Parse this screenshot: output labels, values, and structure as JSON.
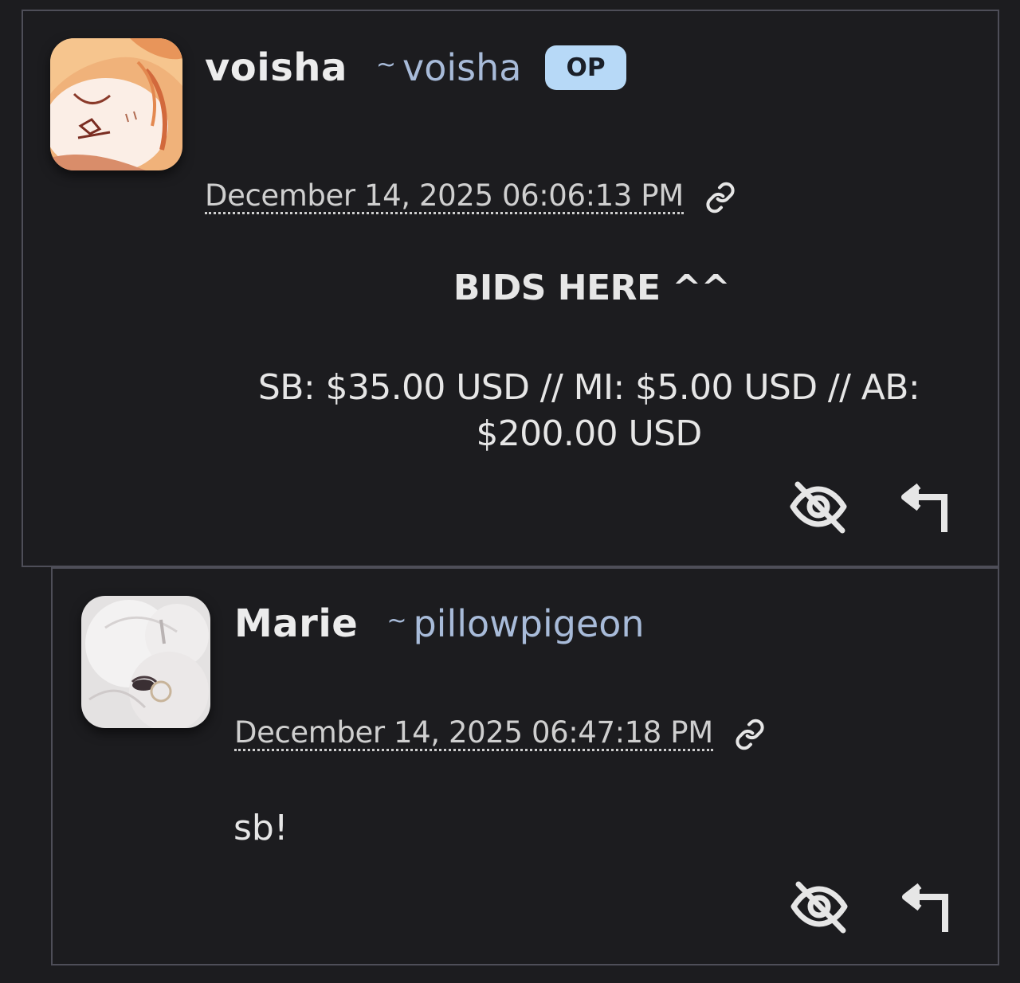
{
  "comments": [
    {
      "display_name": "voisha",
      "username_prefix": "~",
      "username": "voisha",
      "badge": "OP",
      "timestamp": "December 14, 2025 06:06:13 PM",
      "title": "BIDS HERE ^^",
      "text": "SB: $35.00 USD // MI: $5.00 USD // AB: $200.00 USD",
      "icons": [
        "link-icon",
        "hide-icon",
        "reply-icon"
      ]
    },
    {
      "display_name": "Marie",
      "username_prefix": "~",
      "username": "pillowpigeon",
      "timestamp": "December 14, 2025 06:47:18 PM",
      "text": "sb!",
      "icons": [
        "link-icon",
        "hide-icon",
        "reply-icon"
      ]
    }
  ],
  "colors": {
    "background": "#1c1c1f",
    "border": "#4e4e58",
    "username": "#a8bbd9",
    "badge_bg": "#b7d9f7"
  }
}
